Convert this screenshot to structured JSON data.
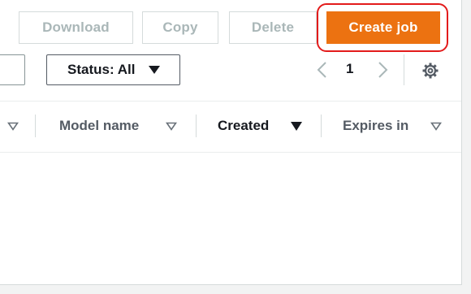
{
  "toolbar": {
    "download_label": "Download",
    "copy_label": "Copy",
    "delete_label": "Delete",
    "create_job_label": "Create job"
  },
  "filter": {
    "status_label": "Status: All"
  },
  "pagination": {
    "current_page": "1"
  },
  "table": {
    "columns": [
      {
        "label": "Model name",
        "sort": "none"
      },
      {
        "label": "Created",
        "sort": "descending"
      },
      {
        "label": "Expires in",
        "sort": "none"
      }
    ]
  },
  "colors": {
    "primary": "#ec7211",
    "highlight": "#e31b1b",
    "disabled_text": "#aab7b8"
  }
}
